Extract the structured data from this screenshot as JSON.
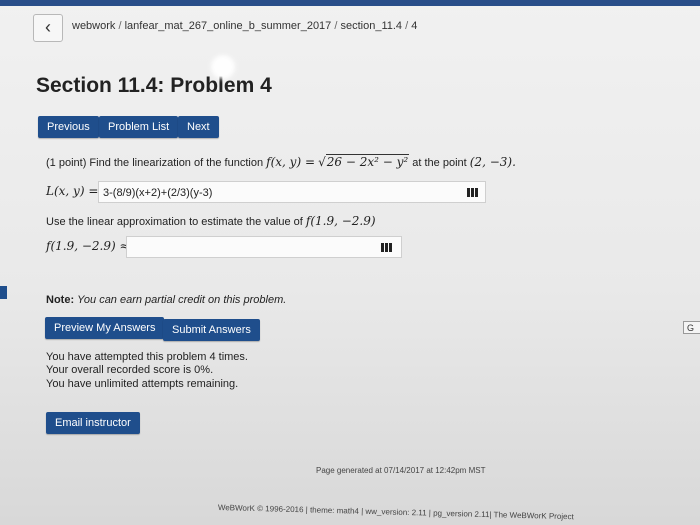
{
  "breadcrumb": {
    "back_icon": "‹",
    "items": [
      "webwork",
      "lanfear_mat_267_online_b_summer_2017",
      "section_11.4",
      "4"
    ],
    "separator": "/"
  },
  "page_title": "Section 11.4: Problem 4",
  "nav": {
    "previous": "Previous",
    "problem_list": "Problem List",
    "next": "Next"
  },
  "problem": {
    "points": "(1 point)",
    "prompt_start": "Find the linearization of the function",
    "function_lhs": "f(x, y) =",
    "radical_content": "26 − 2x² − y²",
    "prompt_mid": "at the point",
    "point": "(2, −3).",
    "answer1_label": "L(x, y) =",
    "answer1_value": "3-(8/9)(x+2)+(2/3)(y-3)",
    "use_text": "Use the linear approximation to estimate the value of",
    "use_expr": "f(1.9, −2.9)",
    "answer2_label": "f(1.9, −2.9) ≈",
    "answer2_value": ""
  },
  "note": {
    "label": "Note:",
    "text": "You can earn partial credit on this problem."
  },
  "actions": {
    "preview": "Preview My Answers",
    "submit": "Submit Answers",
    "email": "Email instructor"
  },
  "status": {
    "attempts": "You have attempted this problem 4 times.",
    "score": "Your overall recorded score is 0%.",
    "remaining": "You have unlimited attempts remaining."
  },
  "side_button": "G",
  "footer": {
    "generated": "Page generated at 07/14/2017 at 12:42pm MST",
    "credits": "WeBWorK © 1996-2016 | theme: math4 | ww_version: 2.11 | pg_version 2.11| The WeBWorK Project"
  },
  "colors": {
    "accent": "#1f4e8c",
    "top_bar": "#2a4f8a"
  },
  "icons": {
    "back": "chevron-left-icon",
    "answer_tools": "grid-icon"
  }
}
